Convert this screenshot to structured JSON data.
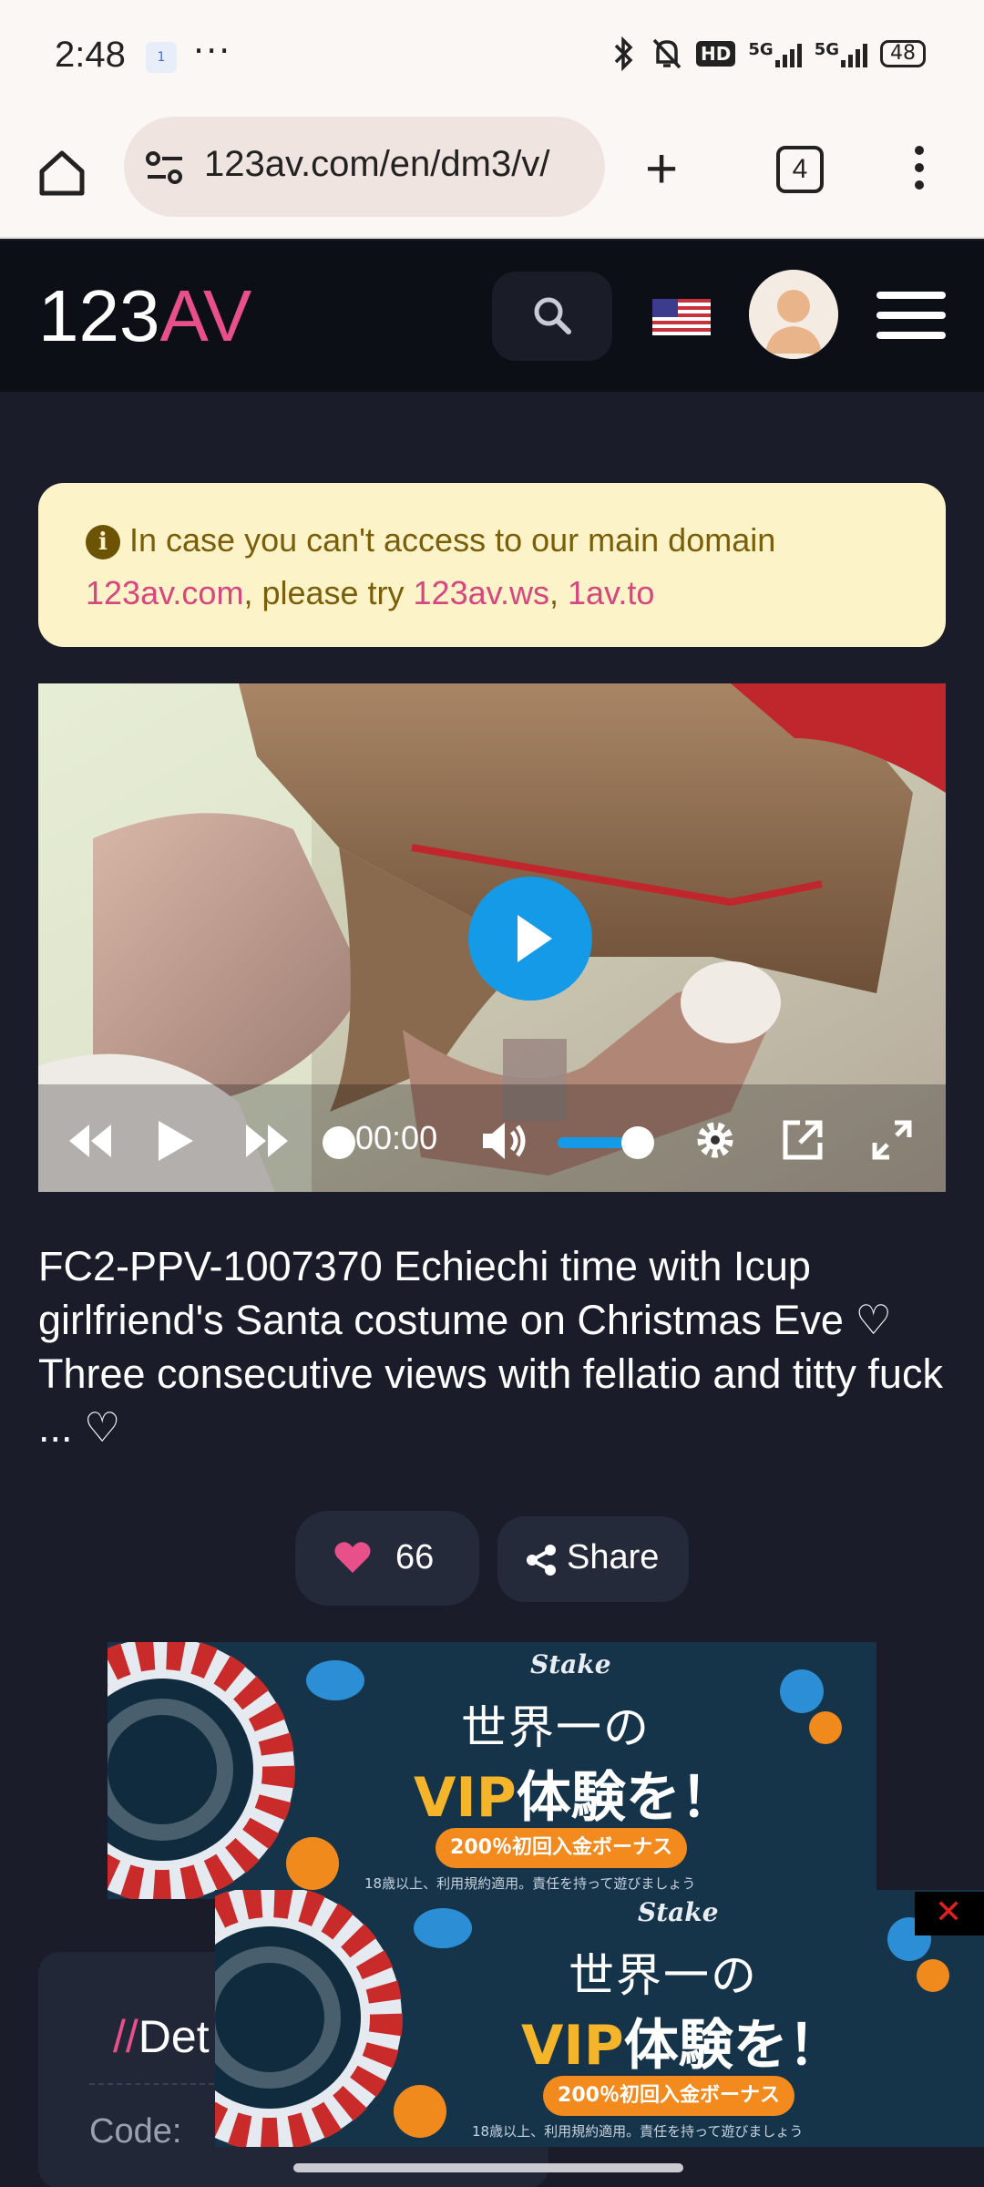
{
  "status_bar": {
    "time": "2:48",
    "sim_badge": "1",
    "more": "···",
    "hd_badge": "HD",
    "signal_1": "5G",
    "signal_2": "5G",
    "battery": "48"
  },
  "browser": {
    "url": "123av.com/en/dm3/v/",
    "tab_count": "4"
  },
  "site": {
    "logo_number": "123",
    "logo_letters": "AV",
    "brand_color": "#e8508a"
  },
  "notice": {
    "text_1": "In case you can't access to our main domain",
    "link_main": "123av.com",
    "text_2": ", please try ",
    "link_alt_1": "123av.ws",
    "separator": ", ",
    "link_alt_2": "1av.to"
  },
  "player": {
    "time": "00:00",
    "accent_color": "#159ae8"
  },
  "video": {
    "title": "FC2-PPV-1007370 Echiechi time with Icup girlfriend's Santa costume on Christmas Eve ♡ Three consecutive views with fellatio and titty fuck ... ♡",
    "likes": "66",
    "share_label": "Share"
  },
  "ads": [
    {
      "brand": "Stake",
      "headline_1": "世界一の",
      "headline_vip": "VIP",
      "headline_2": "体験を！",
      "bonus": "200％初回入金ボーナス",
      "fine_print": "18歳以上、利用規約適用。責任を持って遊びましょう"
    },
    {
      "brand": "Stake",
      "headline_1": "世界一の",
      "headline_vip": "VIP",
      "headline_2": "体験を！",
      "bonus": "200％初回入金ボーナス",
      "fine_print": "18歳以上、利用規約適用。責任を持って遊びましょう"
    }
  ],
  "ad_close": "✕",
  "details": {
    "prefix": "//",
    "heading": "Det",
    "code_label": "Code:"
  }
}
